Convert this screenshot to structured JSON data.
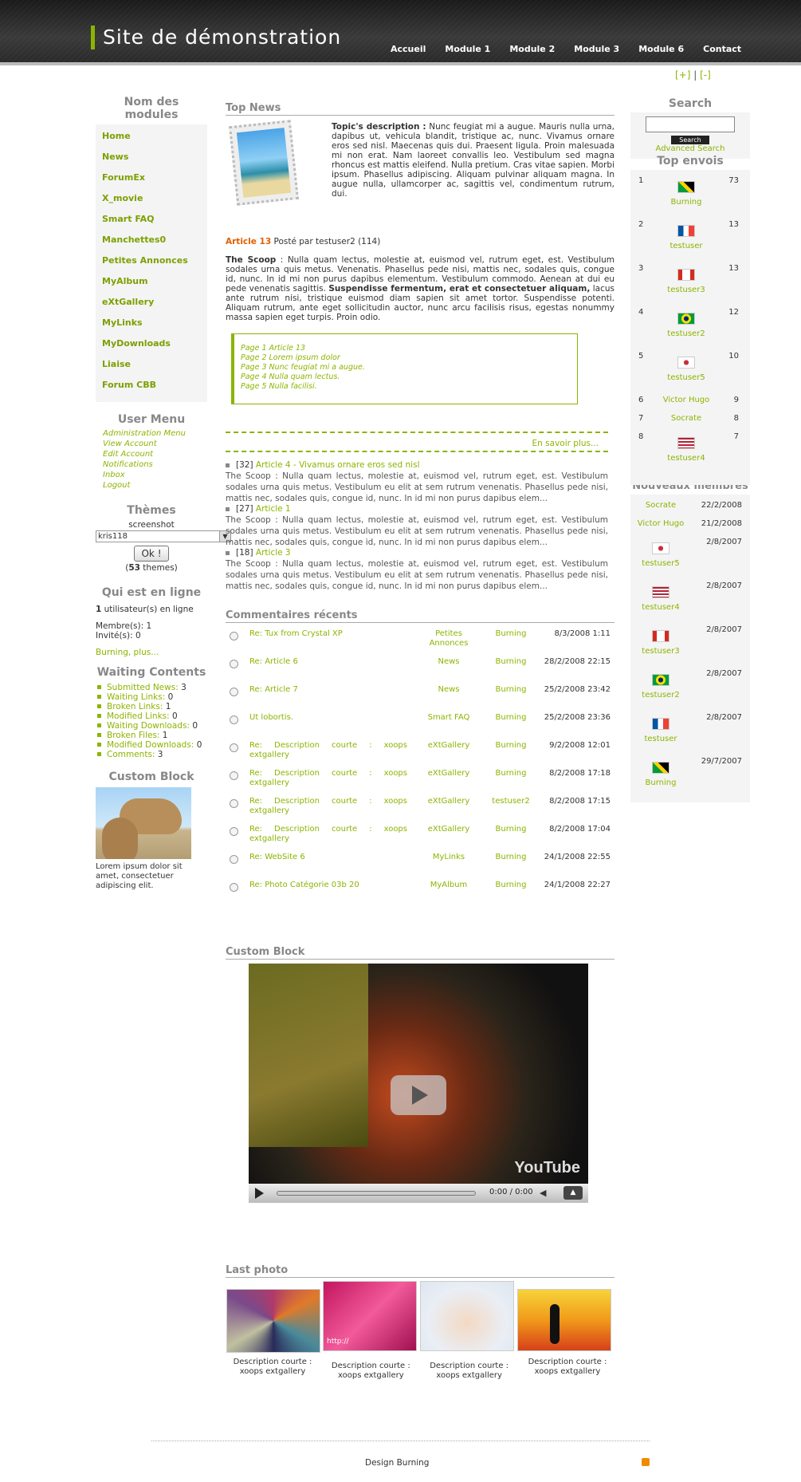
{
  "header": {
    "title": "Site de démonstration",
    "nav": [
      "Accueil",
      "Module 1",
      "Module 2",
      "Module 3",
      "Module 6",
      "Contact"
    ],
    "zoom_plus": "[+]",
    "zoom_sep": "|",
    "zoom_minus": "[-]"
  },
  "left": {
    "modules_title": "Nom des modules",
    "modules": [
      "Home",
      "News",
      "ForumEx",
      "X_movie",
      "Smart FAQ",
      "Manchettes0",
      "Petites Annonces",
      "MyAlbum",
      "eXtGallery",
      "MyLinks",
      "MyDownloads",
      "Liaise",
      "Forum CBB"
    ],
    "usermenu_title": "User Menu",
    "usermenu": [
      "Administration Menu",
      "View Account",
      "Edit Account",
      "Notifications",
      "Inbox",
      "Logout"
    ],
    "themes_title": "Thèmes",
    "screenshot": "screenshot",
    "theme_value": "kris118",
    "ok": "Ok !",
    "themes_count": "53",
    "themes_suffix": "themes",
    "online_title": "Qui est en ligne",
    "online_count": "1",
    "online_text": "utilisateur(s) en ligne",
    "members": "Membre(s): 1",
    "guests": "Invité(s): 0",
    "online_users": "Burning, plus...",
    "waiting_title": "Waiting Contents",
    "waiting": [
      {
        "label": "Submitted News:",
        "v": "3"
      },
      {
        "label": "Waiting Links:",
        "v": "0"
      },
      {
        "label": "Broken Links:",
        "v": "1"
      },
      {
        "label": "Modified Links:",
        "v": "0"
      },
      {
        "label": "Waiting Downloads:",
        "v": "0"
      },
      {
        "label": "Broken Files:",
        "v": "1"
      },
      {
        "label": "Modified Downloads:",
        "v": "0"
      },
      {
        "label": "Comments:",
        "v": "3"
      }
    ],
    "custom_title": "Custom Block",
    "custom_text": "Lorem ipsum dolor sit amet, consectetuer adipiscing elit."
  },
  "topnews": {
    "title": "Top News",
    "desc_label": "Topic's description :",
    "desc": "Nunc feugiat mi a augue. Mauris nulla urna, dapibus ut, vehicula blandit, tristique ac, nunc. Vivamus ornare eros sed nisl. Maecenas quis dui. Praesent ligula. Proin malesuada mi non erat. Nam laoreet convallis leo. Vestibulum sed magna rhoncus est mattis eleifend. Nulla pretium. Cras vitae sapien. Morbi ipsum. Phasellus adipiscing. Aliquam pulvinar aliquam magna. In augue nulla, ullamcorper ac, sagittis vel, condimentum rutrum, dui.",
    "art_title": "Article 13",
    "art_posted": "Posté par testuser2 (114)",
    "scoop_label": "The Scoop",
    "scoop": ": Nulla quam lectus, molestie at, euismod vel, rutrum eget, est. Vestibulum sodales urna quis metus. Venenatis. Phasellus pede nisi, mattis nec, sodales quis, congue id, nunc. In id mi non purus dapibus elementum. Vestibulum commodo. Aenean at dui eu pede venenatis sagittis.",
    "scoop_bold": "Suspendisse fermentum, erat et consectetuer aliquam,",
    "scoop_end": "lacus ante rutrum nisi, tristique euismod diam sapien sit amet tortor. Suspendisse potenti. Aliquam rutrum, ante eget sollicitudin auctor, nunc arcu facilisis risus, egestas nonummy massa sapien eget turpis. Proin odio.",
    "pages": [
      "Page 1 Article 13",
      "Page 2 Lorem ipsum dolor",
      "Page 3 Nunc feugiat mi a augue.",
      "Page 4 Nulla quam lectus.",
      "Page 5 Nulla facilisi."
    ],
    "more": "En savoir plus...",
    "list": [
      {
        "n": "[32]",
        "t": "Article 4 - Vivamus ornare eros sed nisl",
        "d": "The Scoop : Nulla quam lectus, molestie at, euismod vel, rutrum eget, est. Vestibulum sodales urna quis metus. Vestibulum eu elit at sem rutrum venenatis. Phasellus pede nisi, mattis nec, sodales quis, congue id, nunc. In id mi non purus dapibus elem..."
      },
      {
        "n": "[27]",
        "t": "Article 1",
        "d": "The Scoop : Nulla quam lectus, molestie at, euismod vel, rutrum eget, est. Vestibulum sodales urna quis metus. Vestibulum eu elit at sem rutrum venenatis. Phasellus pede nisi, mattis nec, sodales quis, congue id, nunc. In id mi non purus dapibus elem..."
      },
      {
        "n": "[18]",
        "t": "Article 3",
        "d": "The Scoop : Nulla quam lectus, molestie at, euismod vel, rutrum eget, est. Vestibulum sodales urna quis metus. Vestibulum eu elit at sem rutrum venenatis. Phasellus pede nisi, mattis nec, sodales quis, congue id, nunc. In id mi non purus dapibus elem..."
      }
    ]
  },
  "comments": {
    "title": "Commentaires récents",
    "rows": [
      {
        "t": "Re: Tux from Crystal XP",
        "m": "Petites Annonces",
        "u": "Burning",
        "d": "8/3/2008 1:11"
      },
      {
        "t": "Re: Article 6",
        "m": "News",
        "u": "Burning",
        "d": "28/2/2008 22:15"
      },
      {
        "t": "Re: Article 7",
        "m": "News",
        "u": "Burning",
        "d": "25/2/2008 23:42"
      },
      {
        "t": "Ut lobortis.",
        "m": "Smart FAQ",
        "u": "Burning",
        "d": "25/2/2008 23:36"
      },
      {
        "t": "Re: Description courte : xoops extgallery",
        "m": "eXtGallery",
        "u": "Burning",
        "d": "9/2/2008 12:01"
      },
      {
        "t": "Re: Description courte : xoops extgallery",
        "m": "eXtGallery",
        "u": "Burning",
        "d": "8/2/2008 17:18"
      },
      {
        "t": "Re: Description courte : xoops extgallery",
        "m": "eXtGallery",
        "u": "testuser2",
        "d": "8/2/2008 17:15"
      },
      {
        "t": "Re: Description courte : xoops extgallery",
        "m": "eXtGallery",
        "u": "Burning",
        "d": "8/2/2008 17:04"
      },
      {
        "t": "Re: WebSite 6",
        "m": "MyLinks",
        "u": "Burning",
        "d": "24/1/2008 22:55"
      },
      {
        "t": "Re: Photo Catégorie 03b 20",
        "m": "MyAlbum",
        "u": "Burning",
        "d": "24/1/2008 22:27"
      }
    ]
  },
  "video": {
    "title": "Custom Block",
    "time": "0:00 / 0:00",
    "brand": "YouTube"
  },
  "photos": {
    "title": "Last photo",
    "captions": [
      "Description courte : xoops extgallery",
      "Description courte : xoops extgallery",
      "Description courte : xoops extgallery",
      "Description courte : xoops extgallery"
    ],
    "watermark": "http://"
  },
  "right": {
    "search_title": "Search",
    "search_btn": "Search",
    "adv": "Advanced Search",
    "top_title": "Top envois",
    "top": [
      {
        "r": "1",
        "u": "Burning",
        "n": "73",
        "f": "jm"
      },
      {
        "r": "2",
        "u": "testuser",
        "n": "13",
        "f": "fr"
      },
      {
        "r": "3",
        "u": "testuser3",
        "n": "13",
        "f": "ca"
      },
      {
        "r": "4",
        "u": "testuser2",
        "n": "12",
        "f": "br"
      },
      {
        "r": "5",
        "u": "testuser5",
        "n": "10",
        "f": "kr"
      },
      {
        "r": "6",
        "u": "Victor Hugo",
        "n": "9",
        "f": ""
      },
      {
        "r": "7",
        "u": "Socrate",
        "n": "8",
        "f": ""
      },
      {
        "r": "8",
        "u": "testuser4",
        "n": "7",
        "f": "us"
      }
    ],
    "new_title": "Nouveaux membres",
    "new": [
      {
        "u": "Socrate",
        "d": "22/2/2008",
        "f": ""
      },
      {
        "u": "Victor Hugo",
        "d": "21/2/2008",
        "f": ""
      },
      {
        "u": "testuser5",
        "d": "2/8/2007",
        "f": "kr"
      },
      {
        "u": "testuser4",
        "d": "2/8/2007",
        "f": "us"
      },
      {
        "u": "testuser3",
        "d": "2/8/2007",
        "f": "ca"
      },
      {
        "u": "testuser2",
        "d": "2/8/2007",
        "f": "br"
      },
      {
        "u": "testuser",
        "d": "2/8/2007",
        "f": "fr"
      },
      {
        "u": "Burning",
        "d": "29/7/2007",
        "f": "jm"
      }
    ]
  },
  "footer": {
    "text": "Design Burning"
  },
  "colors": {
    "accent": "#8cb400",
    "header": "#2b2b2b",
    "box": "#f4f4f4"
  }
}
